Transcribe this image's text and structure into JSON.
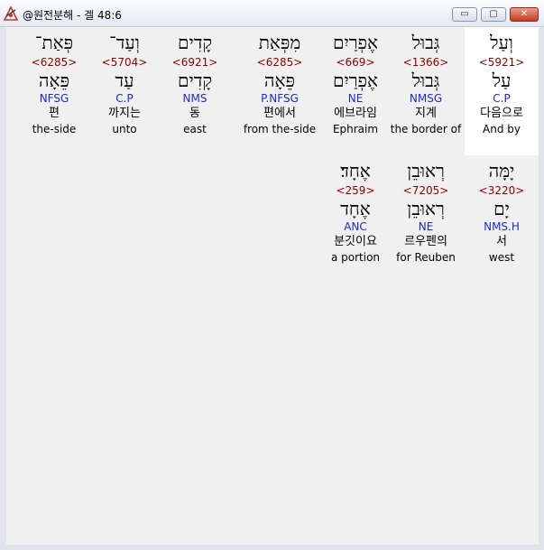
{
  "window": {
    "title": "@원전분해 - 겔 48:6",
    "icon": "hebrew-parsing-app-icon",
    "buttons": {
      "minimize": "▭",
      "maximize": "▢",
      "close": "✕"
    }
  },
  "rows": [
    [
      {
        "hebrew": "וְעַל",
        "strong": "<5921>",
        "lemma": "עַל",
        "morph": "C.P",
        "korean": "다음으로",
        "english": "And by",
        "selected": true
      },
      {
        "hebrew": "גְּבוּל",
        "strong": "<1366>",
        "lemma": "גְּבוּל",
        "morph": "NMSG",
        "korean": "지계",
        "english": "the border of",
        "selected": false
      },
      {
        "hebrew": "אֶפְרַיִם",
        "strong": "<669>",
        "lemma": "אֶפְרַיִם",
        "morph": "NE",
        "korean": "에브라임",
        "english": "Ephraim",
        "selected": false
      },
      {
        "hebrew": "מִפְּאַת",
        "strong": "<6285>",
        "lemma": "פֵּאָה",
        "morph": "P.NFSG",
        "korean": "편에서",
        "english": "from the-side",
        "selected": false
      },
      {
        "hebrew": "קָדִים",
        "strong": "<6921>",
        "lemma": "קָדִים",
        "morph": "NMS",
        "korean": "동",
        "english": "east",
        "selected": false
      },
      {
        "hebrew": "וְעַד־",
        "strong": "<5704>",
        "lemma": "עַד",
        "morph": "C.P",
        "korean": "까지는",
        "english": "unto",
        "selected": false
      },
      {
        "hebrew": "פְּאַת־",
        "strong": "<6285>",
        "lemma": "פֵּאָה",
        "morph": "NFSG",
        "korean": "편",
        "english": "the-side",
        "selected": false
      }
    ],
    [
      {
        "hebrew": "יָמָּה",
        "strong": "<3220>",
        "lemma": "יָם",
        "morph": "NMS.H",
        "korean": "서",
        "english": "west",
        "selected": false
      },
      {
        "hebrew": "רְאוּבֵן",
        "strong": "<7205>",
        "lemma": "רְאוּבֵן",
        "morph": "NE",
        "korean": "르우펜의",
        "english": "for Reuben",
        "selected": false
      },
      {
        "hebrew": "אֶחָד׃",
        "strong": "<259>",
        "lemma": "אֶחָד",
        "morph": "ANC",
        "korean": "분깃이요",
        "english": "a portion",
        "selected": false
      }
    ]
  ],
  "colors": {
    "strong": "#8b0000",
    "morph": "#1a2cc4",
    "background": "#f0f0f0",
    "selected": "#ffffff"
  }
}
